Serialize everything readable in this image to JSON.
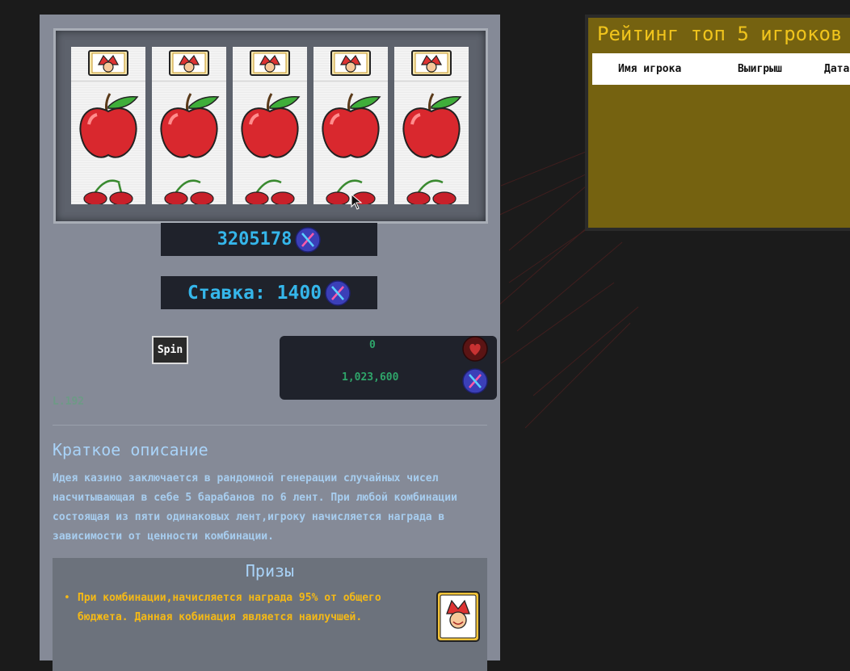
{
  "machine": {
    "reels": [
      {
        "symbols": [
          "joker-icon",
          "apple-icon",
          "cherry-icon"
        ]
      },
      {
        "symbols": [
          "joker-icon",
          "apple-icon",
          "cherry-icon"
        ]
      },
      {
        "symbols": [
          "joker-icon",
          "apple-icon",
          "cherry-icon"
        ]
      },
      {
        "symbols": [
          "joker-icon",
          "apple-icon",
          "cherry-icon"
        ]
      },
      {
        "symbols": [
          "joker-icon",
          "apple-icon",
          "cherry-icon"
        ]
      }
    ],
    "balance": "3205178",
    "bet_text": "Ставка: 1400",
    "spin_label": "Spin",
    "stats": {
      "red_value": "0",
      "blue_value": "1,023,600"
    },
    "level": "L.192"
  },
  "description": {
    "title": "Краткое описание",
    "text": "Идея казино заключается в рандомной генерации случайных чисел насчитывающая в себе 5 барабанов по 6 лент. При любой комбинации состоящая из пяти одинаковых лент,игроку начисляется награда в зависимости от ценности комбинации."
  },
  "prizes": {
    "title": "Призы",
    "items": [
      {
        "text": "При комбинации,начисляется награда 95% от общего бюджета. Данная кобинация является наилучшей.",
        "icon": "joker-card-icon"
      }
    ]
  },
  "leaderboard": {
    "title": "Рейтинг топ 5 игроков",
    "columns": [
      "Имя игрока",
      "Выигрыш",
      "Дата"
    ]
  },
  "colors": {
    "panel": "#858a97",
    "accent_blue": "#35b6ea",
    "stat_green": "#2fa56a",
    "gold": "#f0c41c",
    "board_bg": "#756210"
  }
}
